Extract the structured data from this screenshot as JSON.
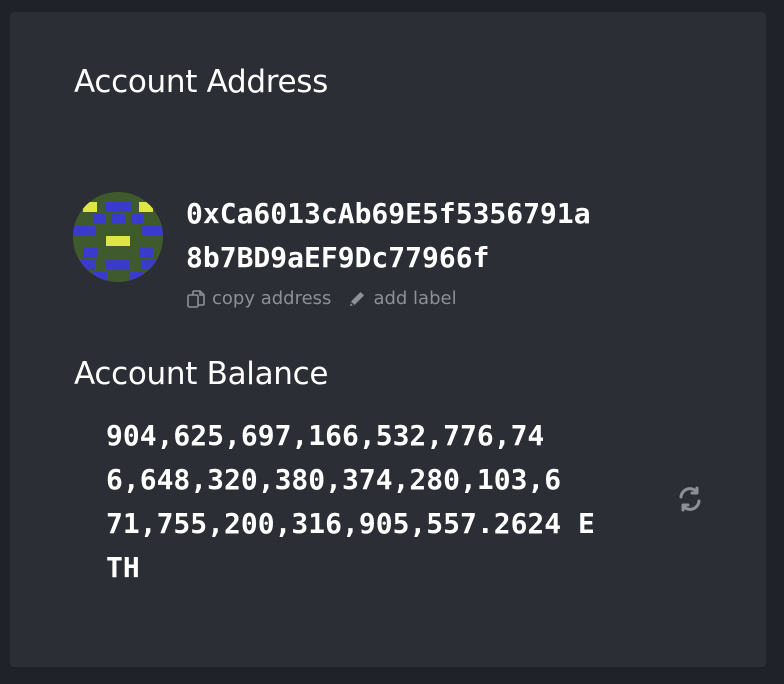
{
  "account": {
    "address_title": "Account Address",
    "address_lines": [
      "0xCa6013cAb69E5f5356791a",
      "8b7BD9aEF9Dc77966f"
    ],
    "actions": {
      "copy_label": "copy address",
      "add_label": "add label"
    },
    "balance_title": "Account Balance",
    "balance_lines": [
      "904,625,697,166,532,776,74",
      "6,648,320,380,374,280,103,6",
      "71,755,200,316,905,557.2624 E",
      "TH"
    ]
  },
  "colors": {
    "background": "#1f2228",
    "panel": "#2b2e35",
    "text": "#ffffff",
    "muted": "#8d9097",
    "identicon_bg": "#3f5a2c",
    "identicon_blue": "#3a3acb",
    "identicon_yellow": "#dfe642"
  },
  "icons": {
    "avatar": "identicon",
    "copy": "copy-icon",
    "edit": "pencil-icon",
    "refresh": "refresh-icon"
  }
}
